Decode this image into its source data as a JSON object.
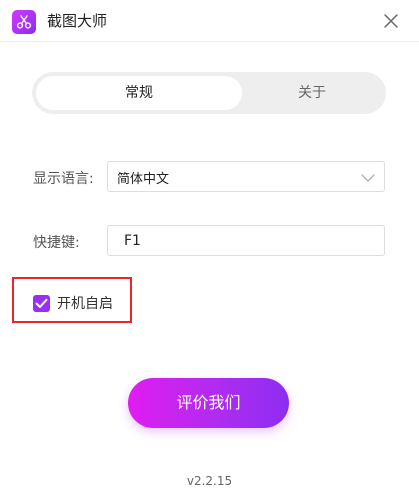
{
  "window": {
    "title": "截图大师",
    "app_icon": "scissors-icon",
    "close_icon": "close-icon"
  },
  "tabs": [
    {
      "label": "常规",
      "active": true
    },
    {
      "label": "关于",
      "active": false
    }
  ],
  "settings": {
    "language_label": "显示语言:",
    "language_value": "简体中文",
    "hotkey_label": "快捷键:",
    "hotkey_value": "F1",
    "autostart_label": "开机自启",
    "autostart_checked": true
  },
  "actions": {
    "rate_label": "评价我们"
  },
  "footer": {
    "version": "v2.2.15"
  },
  "colors": {
    "accent": "#9a2ff2",
    "button_gradient_start": "#e11cf0",
    "button_gradient_end": "#8d2df2",
    "highlight_border": "#e8262b"
  }
}
